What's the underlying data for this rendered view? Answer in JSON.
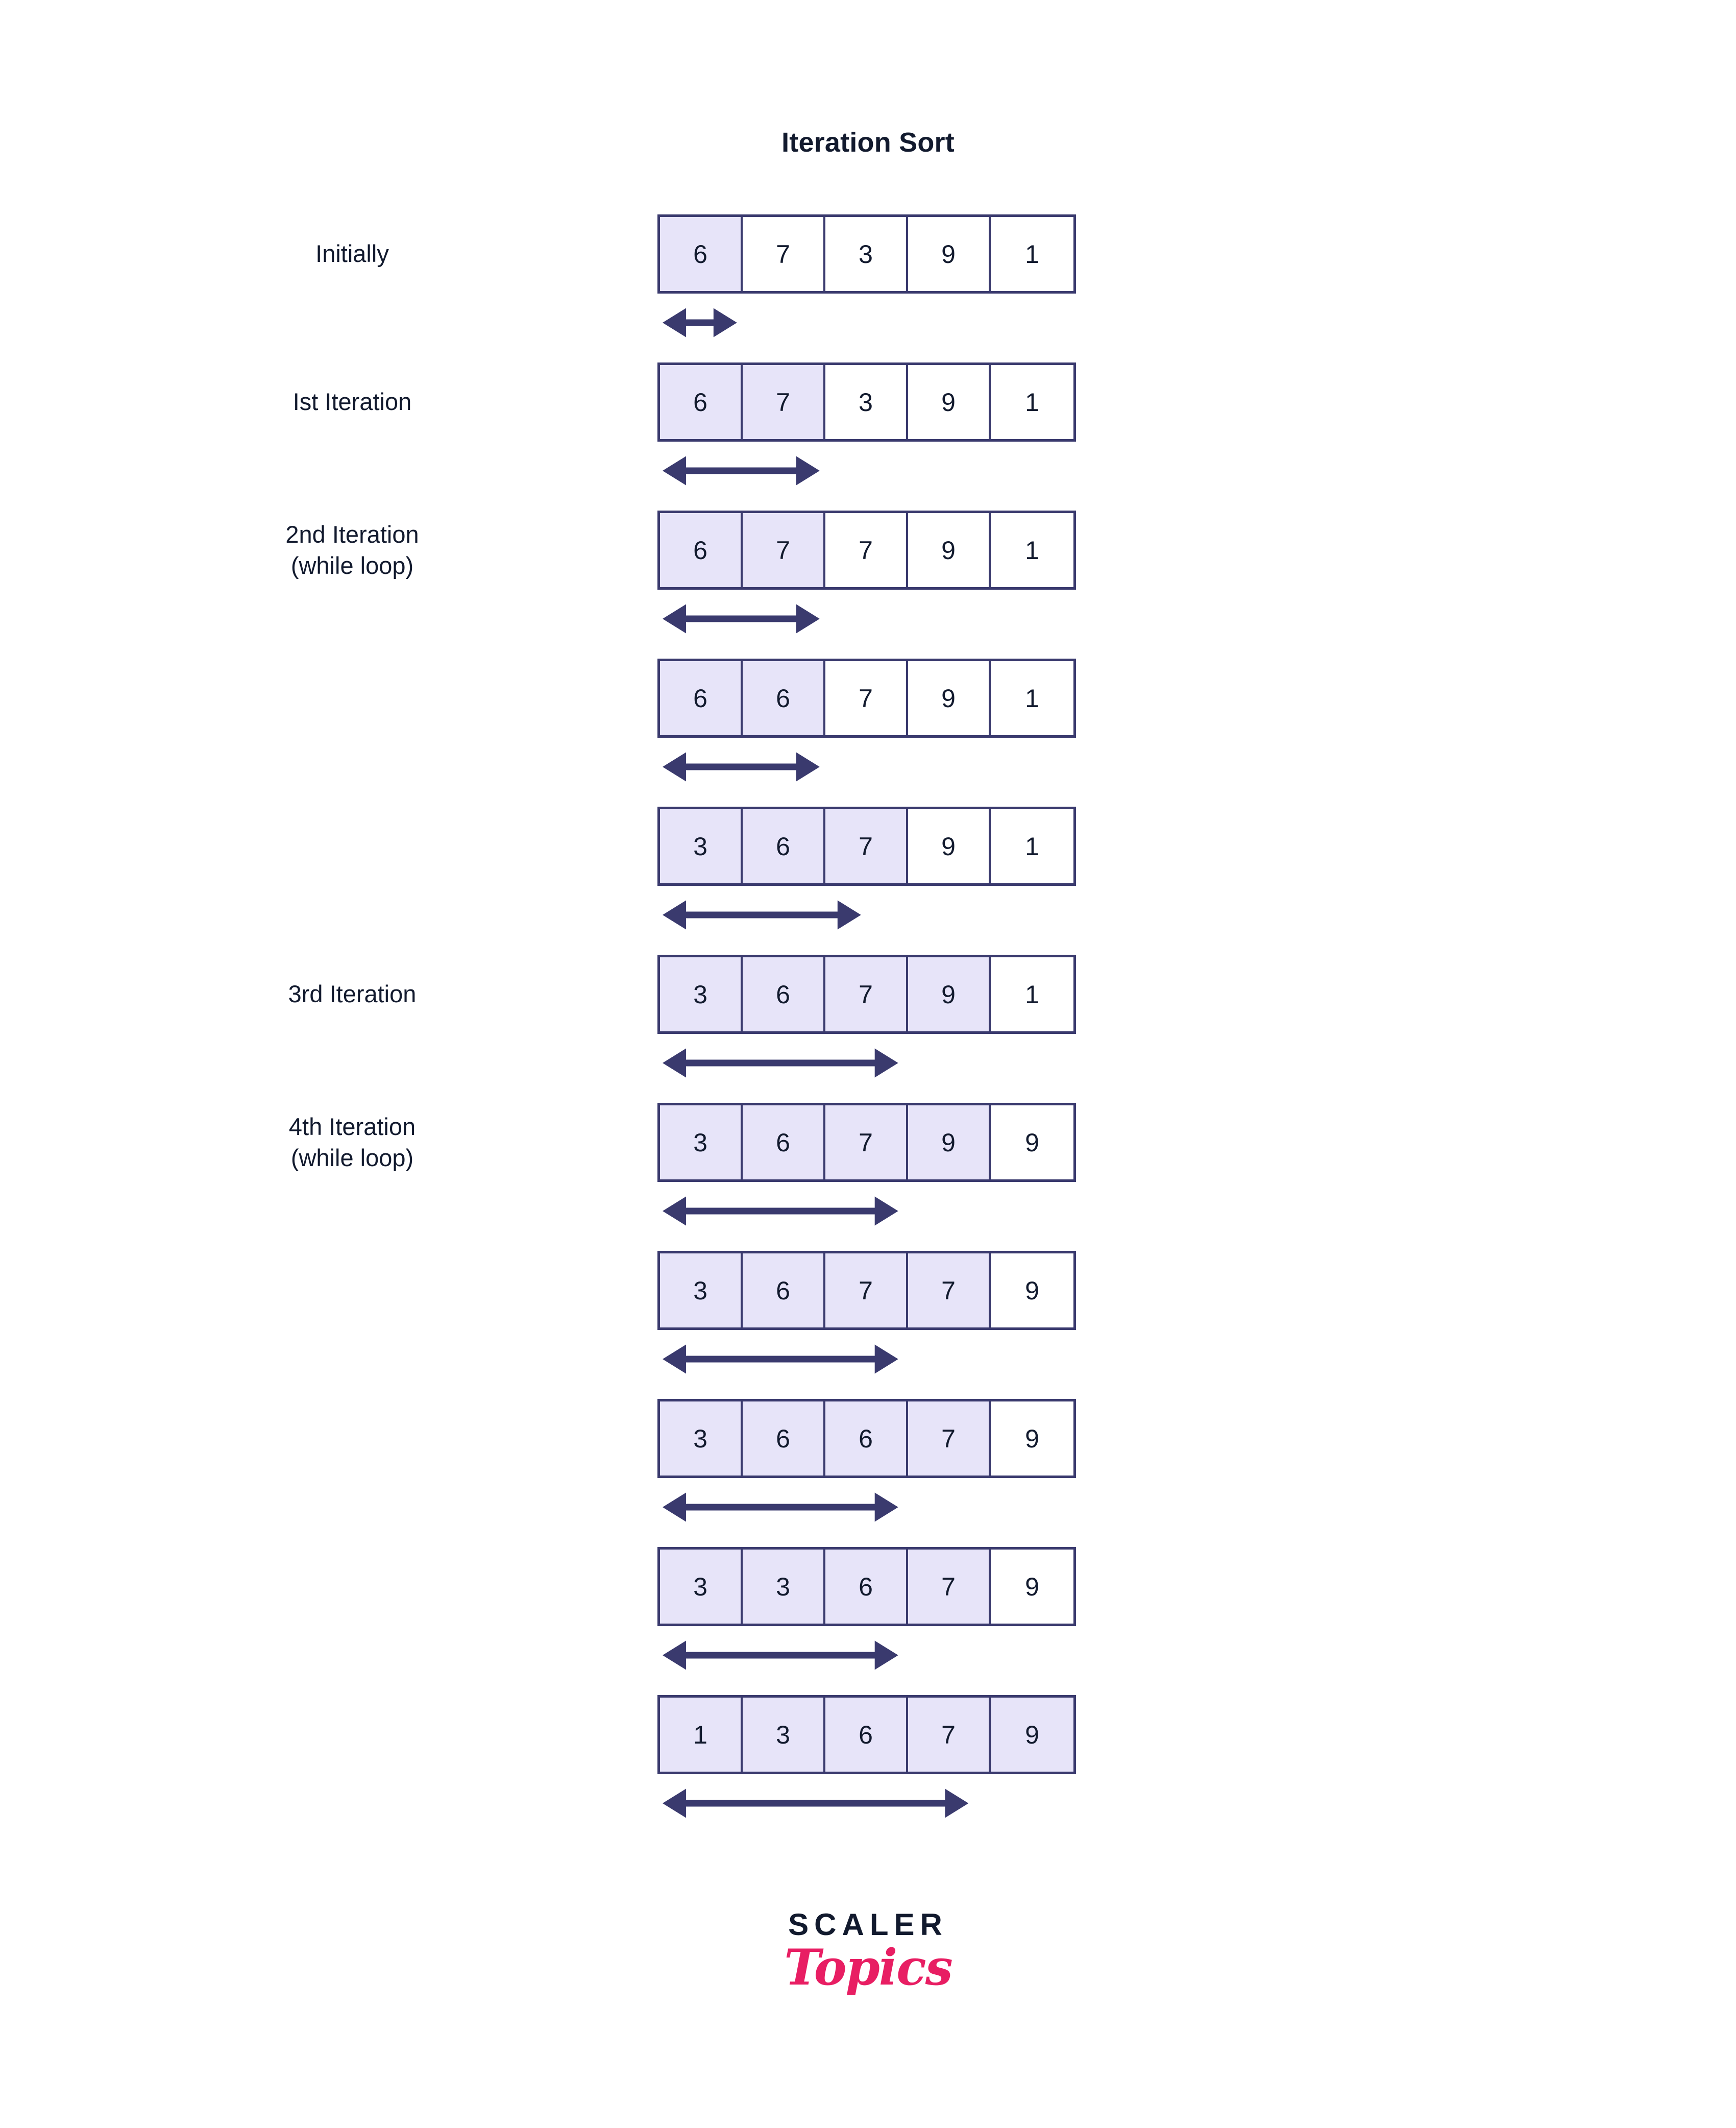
{
  "title": "Iteration Sort",
  "colors": {
    "border": "#3a3a6e",
    "highlight_fill": "#e7e4f9",
    "text": "#121a2e",
    "arrow": "#3a3a6e",
    "brand_pink": "#e81e63",
    "background": "#ffffff"
  },
  "logo": {
    "word_mark": "SCALER",
    "script_mark": "Topics"
  },
  "chart_data": {
    "type": "table",
    "title": "Iteration Sort",
    "array_length": 5,
    "rows": [
      {
        "label_line1": "Initially",
        "label_line2": "",
        "values": [
          "6",
          "7",
          "3",
          "9",
          "1"
        ],
        "highlighted": 1,
        "arrow_span_cells": 0.9
      },
      {
        "label_line1": "Ist Iteration",
        "label_line2": "",
        "values": [
          "6",
          "7",
          "3",
          "9",
          "1"
        ],
        "highlighted": 2,
        "arrow_span_cells": 1.9
      },
      {
        "label_line1": "2nd Iteration",
        "label_line2": "(while loop)",
        "values": [
          "6",
          "7",
          "7",
          "9",
          "1"
        ],
        "highlighted": 2,
        "arrow_span_cells": 1.9
      },
      {
        "label_line1": "",
        "label_line2": "",
        "values": [
          "6",
          "6",
          "7",
          "9",
          "1"
        ],
        "highlighted": 2,
        "arrow_span_cells": 1.9
      },
      {
        "label_line1": "",
        "label_line2": "",
        "values": [
          "3",
          "6",
          "7",
          "9",
          "1"
        ],
        "highlighted": 3,
        "arrow_span_cells": 2.4
      },
      {
        "label_line1": "3rd Iteration",
        "label_line2": "",
        "values": [
          "3",
          "6",
          "7",
          "9",
          "1"
        ],
        "highlighted": 4,
        "arrow_span_cells": 2.85
      },
      {
        "label_line1": "4th Iteration",
        "label_line2": "(while loop)",
        "values": [
          "3",
          "6",
          "7",
          "9",
          "9"
        ],
        "highlighted": 4,
        "arrow_span_cells": 2.85
      },
      {
        "label_line1": "",
        "label_line2": "",
        "values": [
          "3",
          "6",
          "7",
          "7",
          "9"
        ],
        "highlighted": 4,
        "arrow_span_cells": 2.85
      },
      {
        "label_line1": "",
        "label_line2": "",
        "values": [
          "3",
          "6",
          "6",
          "7",
          "9"
        ],
        "highlighted": 4,
        "arrow_span_cells": 2.85
      },
      {
        "label_line1": "",
        "label_line2": "",
        "values": [
          "3",
          "3",
          "6",
          "7",
          "9"
        ],
        "highlighted": 4,
        "arrow_span_cells": 2.85
      },
      {
        "label_line1": "",
        "label_line2": "",
        "values": [
          "1",
          "3",
          "6",
          "7",
          "9"
        ],
        "highlighted": 5,
        "arrow_span_cells": 3.7
      }
    ]
  }
}
